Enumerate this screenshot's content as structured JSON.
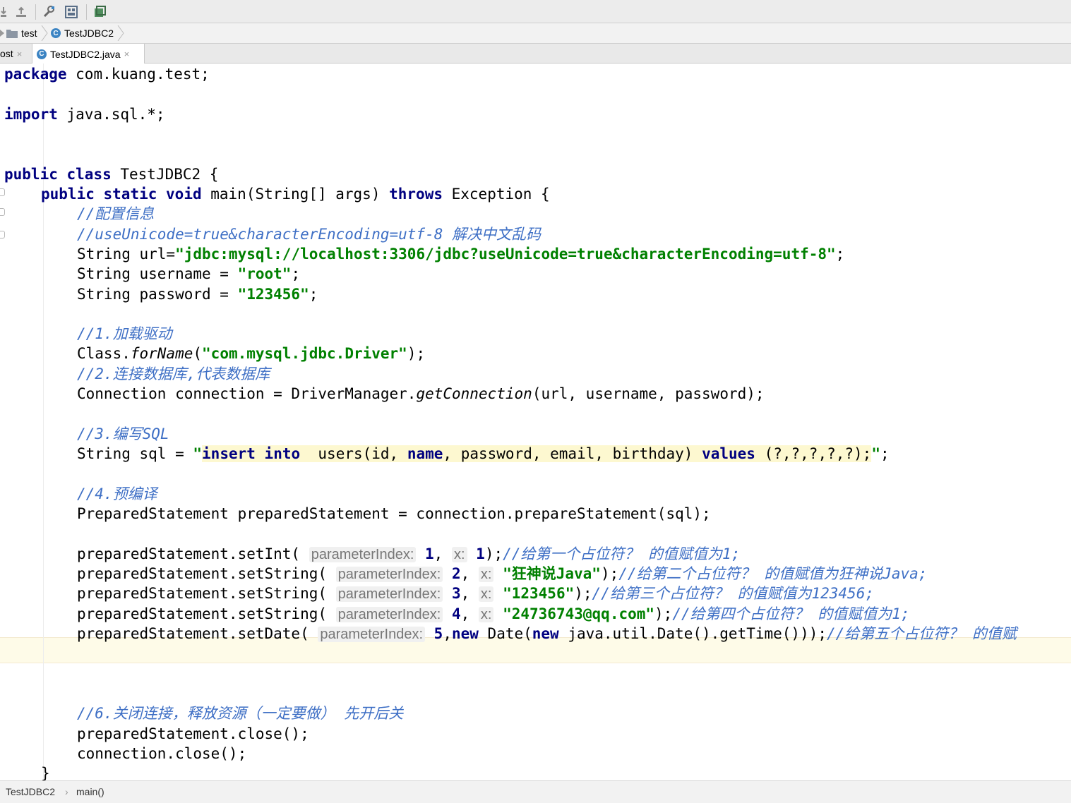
{
  "toolbar": {
    "icons": [
      "download-icon",
      "upload-icon",
      "wrench-icon",
      "structure-icon",
      "sdk-icon"
    ]
  },
  "breadcrumb": {
    "items": [
      {
        "label": "test",
        "icon": "folder-icon"
      },
      {
        "label": "TestJDBC2",
        "icon": "class-icon"
      }
    ]
  },
  "tabs": [
    {
      "label": "ost",
      "active": false
    },
    {
      "label": "TestJDBC2.java",
      "active": true
    }
  ],
  "class_icon_letter": "C",
  "tab_close_glyph": "×",
  "code": {
    "l1": {
      "kw": "package",
      "rest": " com.kuang.test;"
    },
    "l3": {
      "kw": "import",
      "rest": " java.sql.*;"
    },
    "l6": {
      "kw1": "public",
      "kw2": "class",
      "rest": " TestJDBC2 {"
    },
    "l7": {
      "kw1": "public",
      "kw2": "static",
      "kw3": "void",
      "mid": " main(String[] args) ",
      "kw4": "throws",
      "rest": " Exception {"
    },
    "l8": {
      "comment": "//配置信息"
    },
    "l9": {
      "comment": "//useUnicode=true&characterEncoding=utf-8 解决中文乱码"
    },
    "l10": {
      "pre": "String url=",
      "str": "\"jdbc:mysql://localhost:3306/jdbc?useUnicode=true&characterEncoding=utf-8\"",
      "post": ";"
    },
    "l11": {
      "pre": "String username = ",
      "str": "\"root\"",
      "post": ";"
    },
    "l12": {
      "pre": "String password = ",
      "str": "\"123456\"",
      "post": ";"
    },
    "l14": {
      "comment": "//1.加载驱动"
    },
    "l15": {
      "pre": "Class.",
      "method": "forName",
      "open": "(",
      "str": "\"com.mysql.jdbc.Driver\"",
      "post": ");"
    },
    "l16": {
      "comment": "//2.连接数据库,代表数据库"
    },
    "l17": {
      "pre": "Connection connection = DriverManager.",
      "method": "getConnection",
      "post": "(url, username, password);"
    },
    "l19": {
      "comment": "//3.编写SQL"
    },
    "l20": {
      "pre": "String sql = ",
      "q1": "\"",
      "kw1": "insert",
      "sp1": " ",
      "kw2": "into",
      "mid1": "  users(id, ",
      "kw3": "name",
      "mid2": ", password, email, birthday) ",
      "kw4": "values",
      "mid3": " (?,?,?,?,?);",
      "q2": "\"",
      "post": ";"
    },
    "l22": {
      "comment": "//4.预编译"
    },
    "l23": {
      "text": "PreparedStatement preparedStatement = connection.prepareStatement(sql);"
    },
    "l25": {
      "pre": "preparedStatement.setInt( ",
      "hint1": "parameterIndex:",
      "n1": " 1",
      "sep": ", ",
      "hint2": "x:",
      "n2": " 1",
      "post": ");",
      "comment": "//给第一个占位符？ 的值赋值为1;"
    },
    "l26": {
      "pre": "preparedStatement.setString( ",
      "hint1": "parameterIndex:",
      "n1": " 2",
      "sep": ", ",
      "hint2": "x:",
      "str": " \"狂神说Java\"",
      "post": ");",
      "comment": "//给第二个占位符？ 的值赋值为狂神说Java;"
    },
    "l27": {
      "pre": "preparedStatement.setString( ",
      "hint1": "parameterIndex:",
      "n1": " 3",
      "sep": ", ",
      "hint2": "x:",
      "str": " \"123456\"",
      "post": ");",
      "comment": "//给第三个占位符？ 的值赋值为123456;"
    },
    "l28": {
      "pre": "preparedStatement.setString( ",
      "hint1": "parameterIndex:",
      "n1": " 4",
      "sep": ", ",
      "hint2": "x:",
      "str": " \"24736743@qq.com\"",
      "post": ");",
      "comment": "//给第四个占位符？ 的值赋值为1;"
    },
    "l29": {
      "pre": "preparedStatement.setDate( ",
      "hint1": "parameterIndex:",
      "n1": " 5",
      "sep": ",",
      "kw1": "new",
      "mid": " Date(",
      "kw2": "new",
      "post": " java.util.Date().getTime()));",
      "comment": "//给第五个占位符？ 的值赋"
    },
    "l33": {
      "comment": "//6.关闭连接，释放资源（一定要做） 先开后关"
    },
    "l34": {
      "text": "preparedStatement.close();"
    },
    "l35": {
      "text": "connection.close();"
    },
    "l36": {
      "text": "}"
    }
  },
  "status": {
    "crumb1": "TestJDBC2",
    "sep": "›",
    "crumb2": "main()"
  },
  "colors": {
    "keyword": "#000080",
    "string": "#008000",
    "comment": "#3e6fc5",
    "caret_line": "#fefbe8",
    "param_hint": "#777777"
  }
}
